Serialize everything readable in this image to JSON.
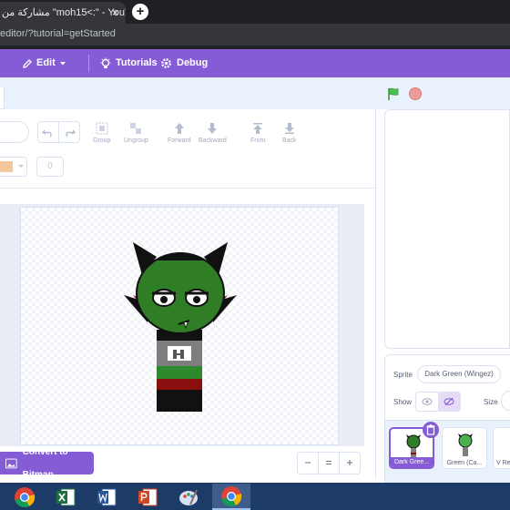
{
  "browser": {
    "tab_title": "‫\"moh15<:\" - YouTube\" مشاركة من‬",
    "tab_close": "×",
    "new_tab": "+",
    "url": "editor/?tutorial=getStarted"
  },
  "menubar": {
    "edit_label": "Edit",
    "tutorials_label": "Tutorials",
    "debug_label": "Debug"
  },
  "paint_toolbar": {
    "group": "Group",
    "ungroup": "Ungroup",
    "forward": "Forward",
    "backward": "Backward",
    "front": "Front",
    "back": "Back",
    "outline_width": "0"
  },
  "paint_footer": {
    "convert_label": "Convert to Bitmap",
    "zoom_out": "−",
    "zoom_reset": "=",
    "zoom_in": "+"
  },
  "sprite_info": {
    "sprite_label": "Sprite",
    "sprite_name": "Dark Green (Wingez)",
    "show_label": "Show",
    "size_label": "Size"
  },
  "sprites": [
    {
      "name": "Dark Gree..."
    },
    {
      "name": "Green (Ca..."
    },
    {
      "name": "V Re"
    }
  ],
  "colors": {
    "accent": "#855cd6",
    "sprite_green": "#2e7d1e",
    "taskbar": "#1c3b67"
  },
  "taskbar_icons": [
    "chrome-icon",
    "excel-icon",
    "word-icon",
    "powerpoint-icon",
    "paint-icon",
    "chrome-active-icon"
  ]
}
